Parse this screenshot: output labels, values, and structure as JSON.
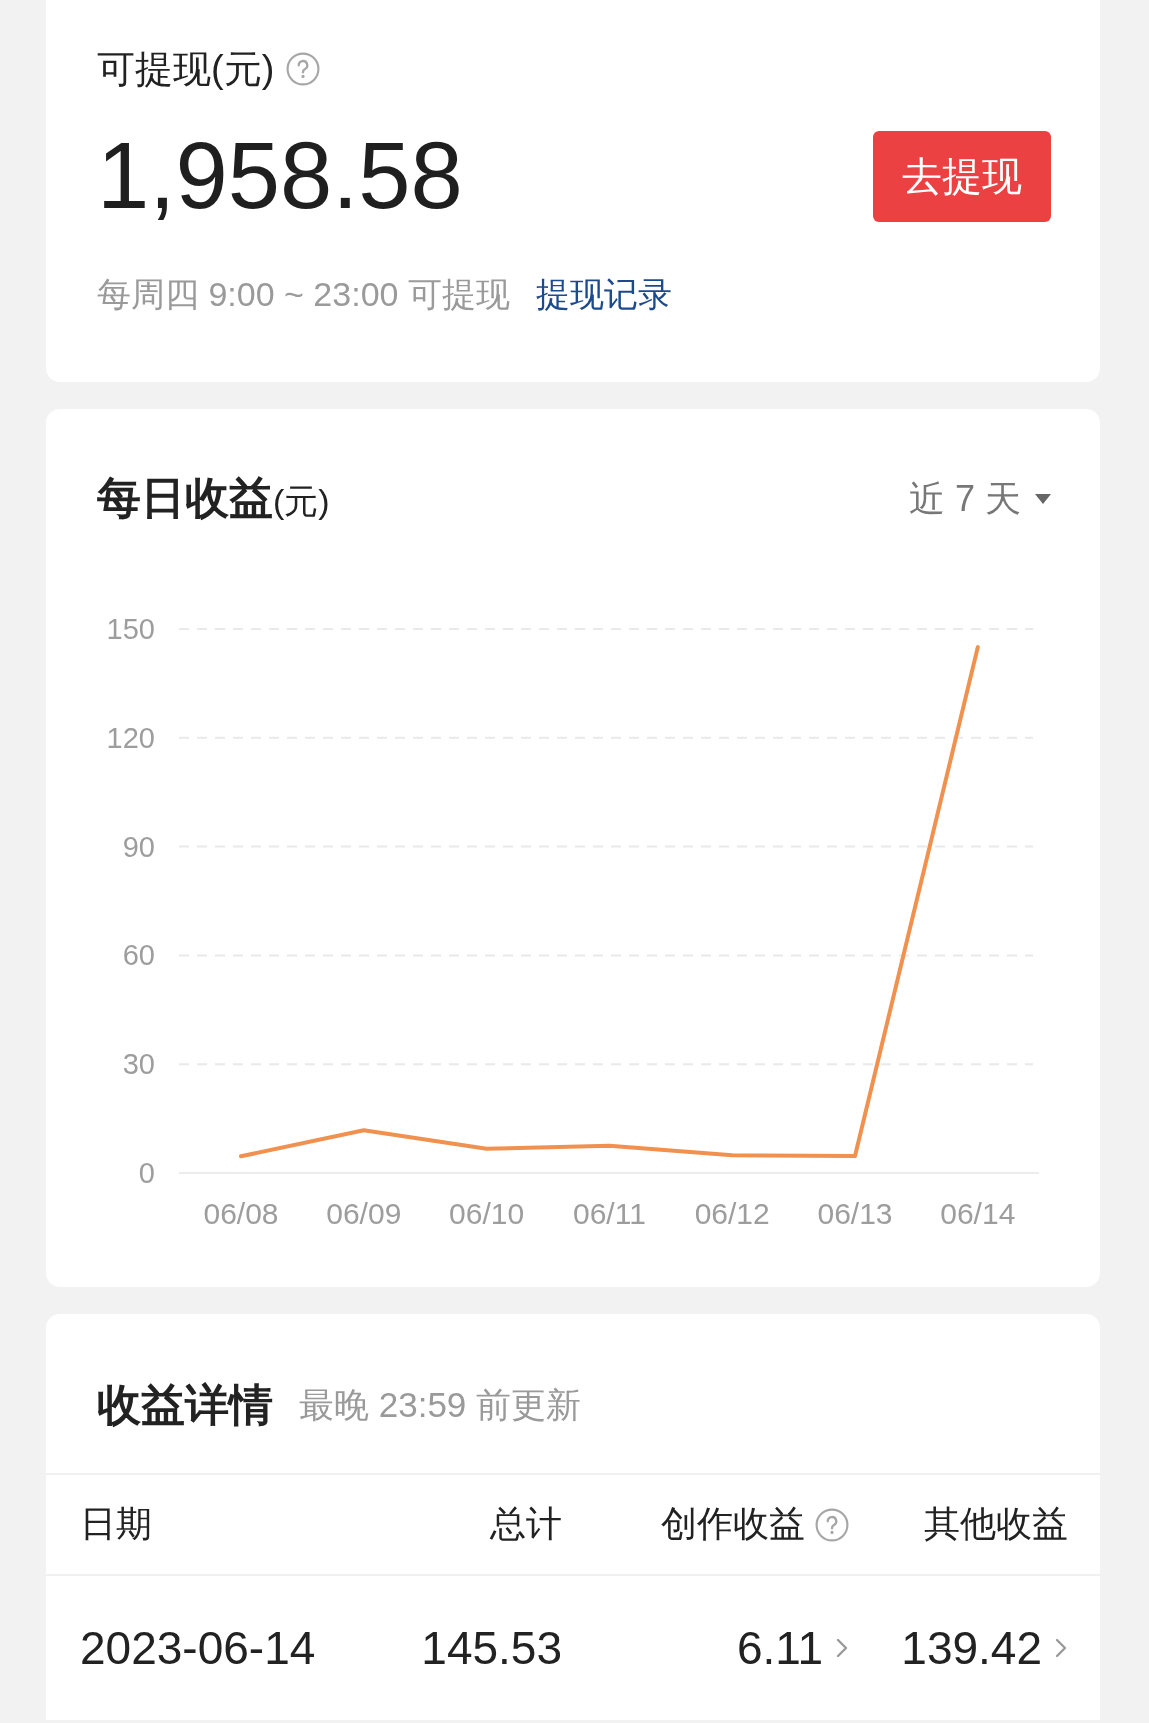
{
  "balance_card": {
    "title": "可提现(元)",
    "help": true,
    "amount": "1,958.58",
    "withdraw_button": "去提现",
    "schedule": "每周四 9:00 ~ 23:00 可提现",
    "records_link": "提现记录"
  },
  "daily_earnings_card": {
    "title": "每日收益",
    "unit": "(元)",
    "range_selector": "近 7 天",
    "chart_data": {
      "type": "line",
      "categories": [
        "06/08",
        "06/09",
        "06/10",
        "06/11",
        "06/12",
        "06/13",
        "06/14"
      ],
      "series": [
        {
          "color": "#f0914f",
          "values": [
            4.6,
            11.8,
            6.7,
            7.5,
            4.9,
            4.7,
            145
          ]
        }
      ],
      "ylim": [
        0,
        150
      ],
      "yticks": [
        0,
        30,
        60,
        90,
        120,
        150
      ],
      "grid": true
    }
  },
  "details_card": {
    "title": "收益详情",
    "subtitle": "最晚 23:59 前更新",
    "table": {
      "columns": [
        {
          "label": "日期",
          "help": false
        },
        {
          "label": "总计",
          "help": false
        },
        {
          "label": "创作收益",
          "help": true
        },
        {
          "label": "其他收益",
          "help": false
        }
      ],
      "rows": [
        {
          "cells": [
            {
              "text": "2023-06-14",
              "link": false
            },
            {
              "text": "145.53",
              "link": false
            },
            {
              "text": "6.11",
              "link": true
            },
            {
              "text": "139.42",
              "link": true
            }
          ]
        }
      ]
    }
  }
}
